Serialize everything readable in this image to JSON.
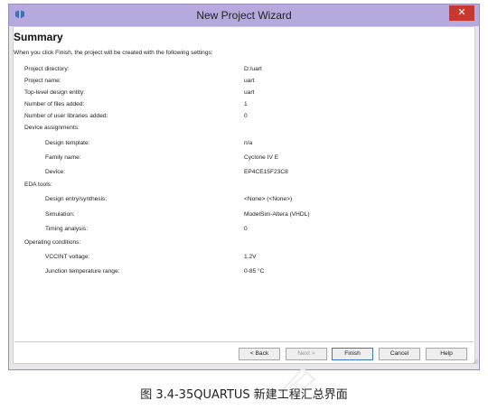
{
  "window": {
    "title": "New Project Wizard",
    "close_glyph": "✕",
    "icon": "app-icon"
  },
  "heading": "Summary",
  "intro": "When you click Finish, the project will be created with the following settings:",
  "rows": [
    {
      "label": "Project directory:",
      "value": "D:/uart"
    },
    {
      "label": "Project name:",
      "value": "uart"
    },
    {
      "label": "Top-level design entity:",
      "value": "uart"
    },
    {
      "label": "Number of files added:",
      "value": "1"
    },
    {
      "label": "Number of user libraries added:",
      "value": "0"
    },
    {
      "label": "Device assignments:",
      "value": ""
    },
    {
      "label": "Design template:",
      "value": "n/a"
    },
    {
      "label": "Family name:",
      "value": "Cyclone IV E"
    },
    {
      "label": "Device:",
      "value": "EP4CE15F23C8"
    },
    {
      "label": "EDA tools:",
      "value": ""
    },
    {
      "label": "Design entry/synthesis:",
      "value": "<None> (<None>)"
    },
    {
      "label": "Simulation:",
      "value": "ModelSim-Altera (VHDL)"
    },
    {
      "label": "Timing analysis:",
      "value": "0"
    },
    {
      "label": "Operating conditions:",
      "value": ""
    },
    {
      "label": "VCCINT voltage:",
      "value": "1.2V"
    },
    {
      "label": "Junction temperature range:",
      "value": "0-85 °C"
    }
  ],
  "buttons": {
    "back": "< Back",
    "next": "Next >",
    "finish": "Finish",
    "cancel": "Cancel",
    "help": "Help"
  },
  "caption": "图 3.4-35QUARTUS 新建工程汇总界面",
  "colors": {
    "titlebar": "#b6a9dd",
    "close": "#c9382e",
    "window_bg": "#e8e6ea"
  }
}
